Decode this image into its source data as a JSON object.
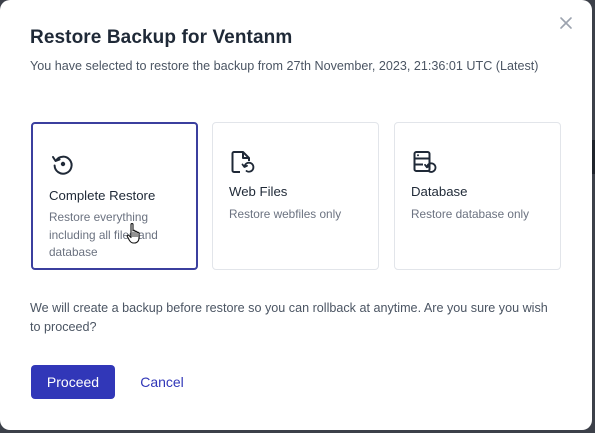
{
  "dialog": {
    "title": "Restore Backup for Ventanm",
    "subtitle": "You have selected to restore the backup from 27th November, 2023, 21:36:01 UTC (Latest)",
    "note": "We will create a backup before restore so you can rollback at anytime. Are you sure you wish to proceed?",
    "close_icon": "close-icon"
  },
  "options": [
    {
      "label": "Complete Restore",
      "description": "Restore everything including all files and database",
      "icon": "restore-icon",
      "selected": true
    },
    {
      "label": "Web Files",
      "description": "Restore webfiles only",
      "icon": "file-restore-icon",
      "selected": false
    },
    {
      "label": "Database",
      "description": "Restore database only",
      "icon": "database-restore-icon",
      "selected": false
    }
  ],
  "actions": {
    "proceed_label": "Proceed",
    "cancel_label": "Cancel"
  },
  "colors": {
    "accent": "#3137b8",
    "selected_border": "#3b3f9e",
    "title": "#1f2937",
    "text": "#4b5563"
  }
}
